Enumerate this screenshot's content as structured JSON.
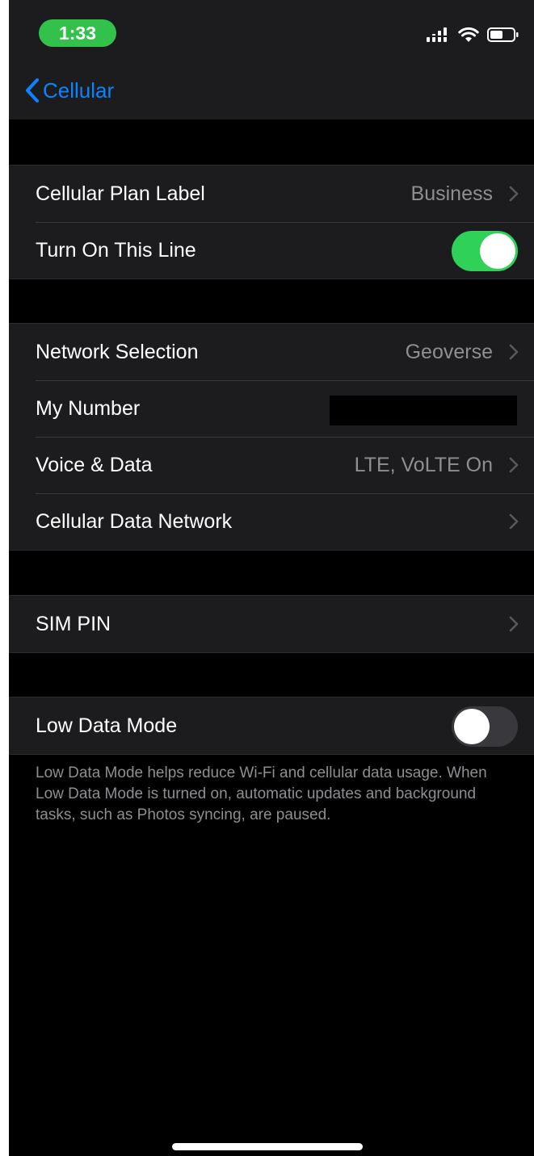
{
  "status_bar": {
    "time": "1:33",
    "icons": [
      "cellular-signal-icon",
      "wifi-icon",
      "battery-icon"
    ]
  },
  "nav": {
    "back_label": "Cellular"
  },
  "groups": [
    {
      "rows": [
        {
          "label": "Cellular Plan Label",
          "value": "Business",
          "type": "disclosure"
        },
        {
          "label": "Turn On This Line",
          "type": "toggle",
          "on": true
        }
      ]
    },
    {
      "rows": [
        {
          "label": "Network Selection",
          "value": "Geoverse",
          "type": "disclosure"
        },
        {
          "label": "My Number",
          "type": "redacted"
        },
        {
          "label": "Voice & Data",
          "value": "LTE, VoLTE On",
          "type": "disclosure"
        },
        {
          "label": "Cellular Data Network",
          "type": "disclosure"
        }
      ]
    },
    {
      "rows": [
        {
          "label": "SIM PIN",
          "type": "disclosure"
        }
      ]
    },
    {
      "rows": [
        {
          "label": "Low Data Mode",
          "type": "toggle",
          "on": false
        }
      ]
    }
  ],
  "low_data_footer": "Low Data Mode helps reduce Wi-Fi and cellular data usage. When Low Data Mode is turned on, automatic updates and background tasks, such as Photos syncing, are paused.",
  "colors": {
    "accent": "#0a84ff",
    "toggle_on": "#30d158",
    "time_pill": "#32c24b",
    "background": "#000000",
    "cell": "#1c1c1e"
  }
}
